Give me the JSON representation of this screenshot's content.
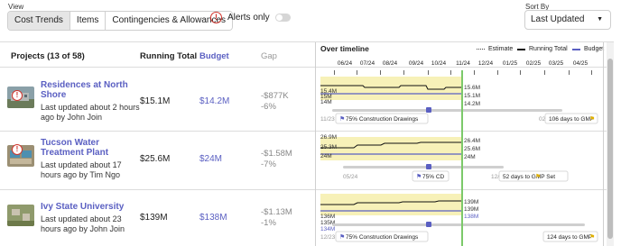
{
  "header": {
    "view_label": "View",
    "tabs": [
      {
        "label": "Cost Trends",
        "active": true
      },
      {
        "label": "Items",
        "active": false
      },
      {
        "label": "Contingencies & Allowances",
        "active": false
      }
    ],
    "alerts_label": "Alerts only",
    "sort_label": "Sort By",
    "sort_value": "Last Updated"
  },
  "columns": {
    "projects": "Projects (13 of 58)",
    "running_total": "Running Total",
    "budget": "Budget",
    "gap": "Gap",
    "timeline": "Over timeline"
  },
  "legend": {
    "estimate": "Estimate",
    "running_total": "Running Total",
    "budget": "Budget"
  },
  "months": [
    "06/24",
    "07/24",
    "08/24",
    "09/24",
    "10/24",
    "11/24",
    "12/24",
    "01/25",
    "02/25",
    "03/25",
    "04/25"
  ],
  "colors": {
    "accent": "#5a5fc2",
    "alert": "#d0342c",
    "estimate_band": "#f7f1b8",
    "today_line": "#7cc96a",
    "gmp": "#e0b000"
  },
  "projects": [
    {
      "name": "Residences at North Shore",
      "updated": "Last updated about 2 hours ago by John Join",
      "total": "$15.1M",
      "budget": "$14.2M",
      "gap": "-$877K",
      "gap_pct": "-6%",
      "alert": true,
      "left_labels": [
        "15.4M",
        "15M",
        "14M"
      ],
      "right_labels": [
        "15.6M",
        "15.1M",
        "14.2M"
      ],
      "start_date": "11/23",
      "milestone": "75% Construction Drawings",
      "end_date": "02/",
      "gmp": "106 days to GMP"
    },
    {
      "name": "Tucson Water Treatment Plant",
      "updated": "Last updated about 17 hours ago by Tim Ngo",
      "total": "$25.6M",
      "budget": "$24M",
      "gap": "-$1.58M",
      "gap_pct": "-7%",
      "alert": true,
      "left_labels": [
        "26.9M",
        "25.3M",
        "24M"
      ],
      "right_labels": [
        "26.4M",
        "25.6M",
        "24M"
      ],
      "start_date": "05/24",
      "milestone": "75% CD",
      "end_date": "12/2",
      "gmp": "52 days to GMP Set"
    },
    {
      "name": "Ivy State University",
      "updated": "Last updated about 23 hours ago by John Join",
      "total": "$139M",
      "budget": "$138M",
      "gap": "-$1.13M",
      "gap_pct": "-1%",
      "alert": false,
      "left_labels": [
        "136M",
        "135M",
        "134M"
      ],
      "right_labels": [
        "139M",
        "139M",
        "138M"
      ],
      "start_date": "12/23",
      "milestone": "75% Construction Drawings",
      "end_date": "",
      "gmp": "124 days to GMP"
    }
  ]
}
